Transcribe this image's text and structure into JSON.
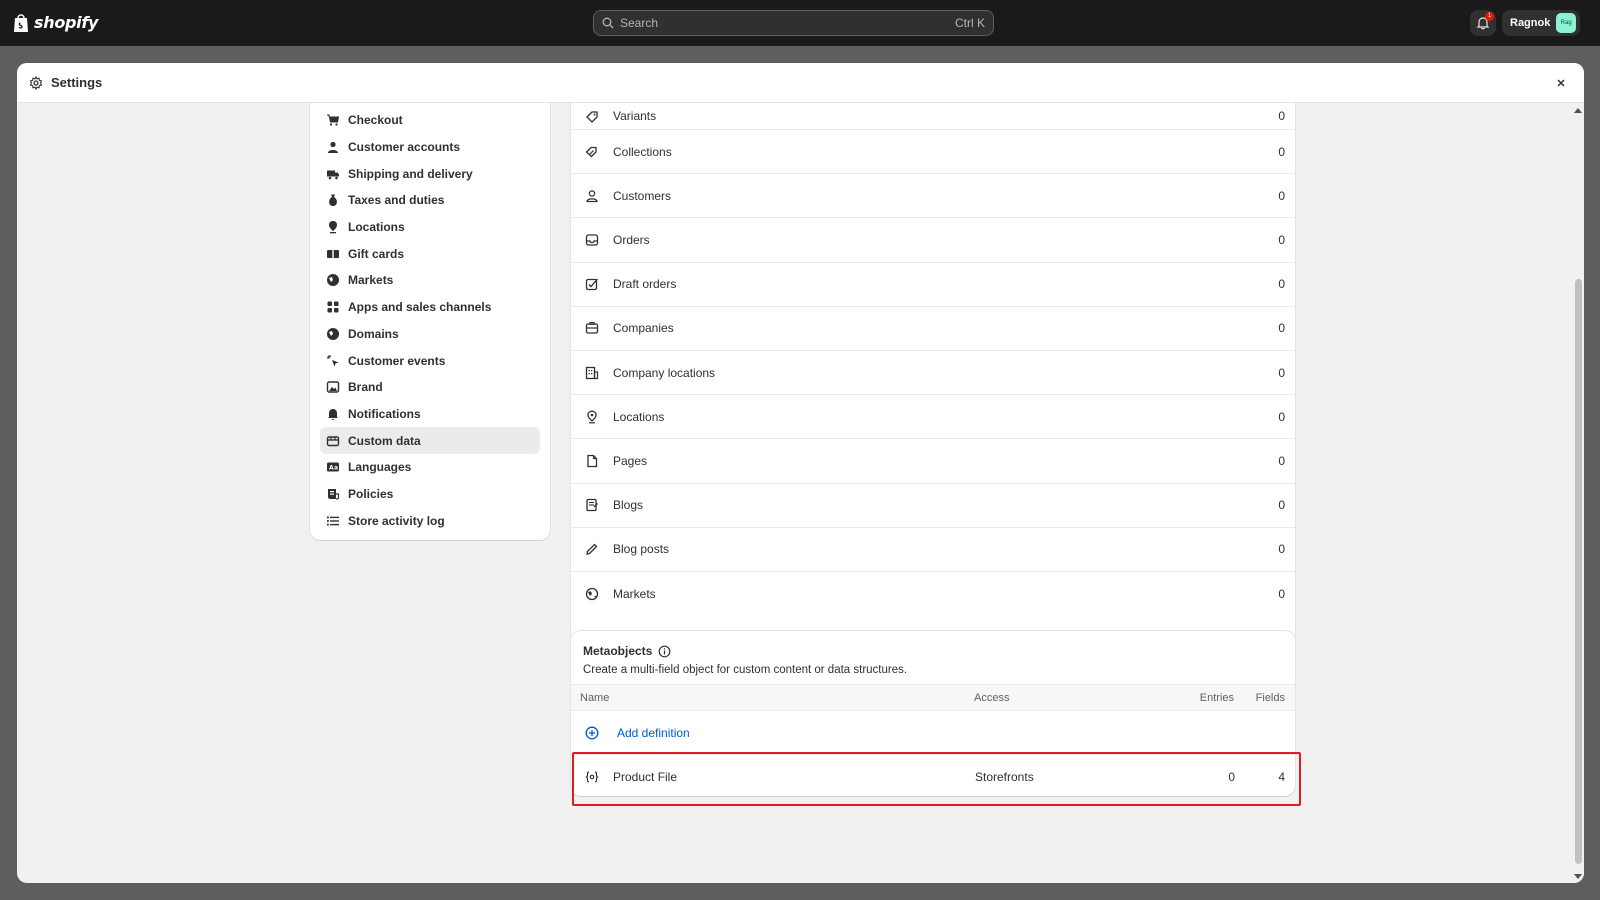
{
  "topbar": {
    "logo_text": "shopify",
    "search_placeholder": "Search",
    "search_shortcut": "Ctrl K",
    "notification_count": "1",
    "user_name": "Ragnok",
    "avatar_initials": "Rag"
  },
  "modal": {
    "title": "Settings"
  },
  "sidebar": {
    "items": [
      {
        "label": "Checkout",
        "icon": "cart-icon"
      },
      {
        "label": "Customer accounts",
        "icon": "person-icon"
      },
      {
        "label": "Shipping and delivery",
        "icon": "truck-icon"
      },
      {
        "label": "Taxes and duties",
        "icon": "money-bag-icon"
      },
      {
        "label": "Locations",
        "icon": "location-pin-icon"
      },
      {
        "label": "Gift cards",
        "icon": "gift-card-icon"
      },
      {
        "label": "Markets",
        "icon": "globe-icon"
      },
      {
        "label": "Apps and sales channels",
        "icon": "apps-icon"
      },
      {
        "label": "Domains",
        "icon": "globe-icon"
      },
      {
        "label": "Customer events",
        "icon": "cursor-click-icon"
      },
      {
        "label": "Brand",
        "icon": "brand-image-icon"
      },
      {
        "label": "Notifications",
        "icon": "bell-icon"
      },
      {
        "label": "Custom data",
        "icon": "database-icon"
      },
      {
        "label": "Languages",
        "icon": "language-icon"
      },
      {
        "label": "Policies",
        "icon": "policy-icon"
      },
      {
        "label": "Store activity log",
        "icon": "list-icon"
      }
    ],
    "active_label": "Custom data"
  },
  "metafield_definitions": [
    {
      "label": "Variants",
      "count": "0"
    },
    {
      "label": "Collections",
      "count": "0"
    },
    {
      "label": "Customers",
      "count": "0"
    },
    {
      "label": "Orders",
      "count": "0"
    },
    {
      "label": "Draft orders",
      "count": "0"
    },
    {
      "label": "Companies",
      "count": "0"
    },
    {
      "label": "Company locations",
      "count": "0"
    },
    {
      "label": "Locations",
      "count": "0"
    },
    {
      "label": "Pages",
      "count": "0"
    },
    {
      "label": "Blogs",
      "count": "0"
    },
    {
      "label": "Blog posts",
      "count": "0"
    },
    {
      "label": "Markets",
      "count": "0"
    }
  ],
  "metaobjects": {
    "title": "Metaobjects",
    "description": "Create a multi-field object for custom content or data structures.",
    "columns": {
      "name": "Name",
      "access": "Access",
      "entries": "Entries",
      "fields": "Fields"
    },
    "add_label": "Add definition",
    "rows": [
      {
        "name": "Product File",
        "access": "Storefronts",
        "entries": "0",
        "fields": "4"
      }
    ]
  },
  "colors": {
    "topbar": "#1a1a1a",
    "link": "#005bd3",
    "highlight": "#e01b24"
  }
}
